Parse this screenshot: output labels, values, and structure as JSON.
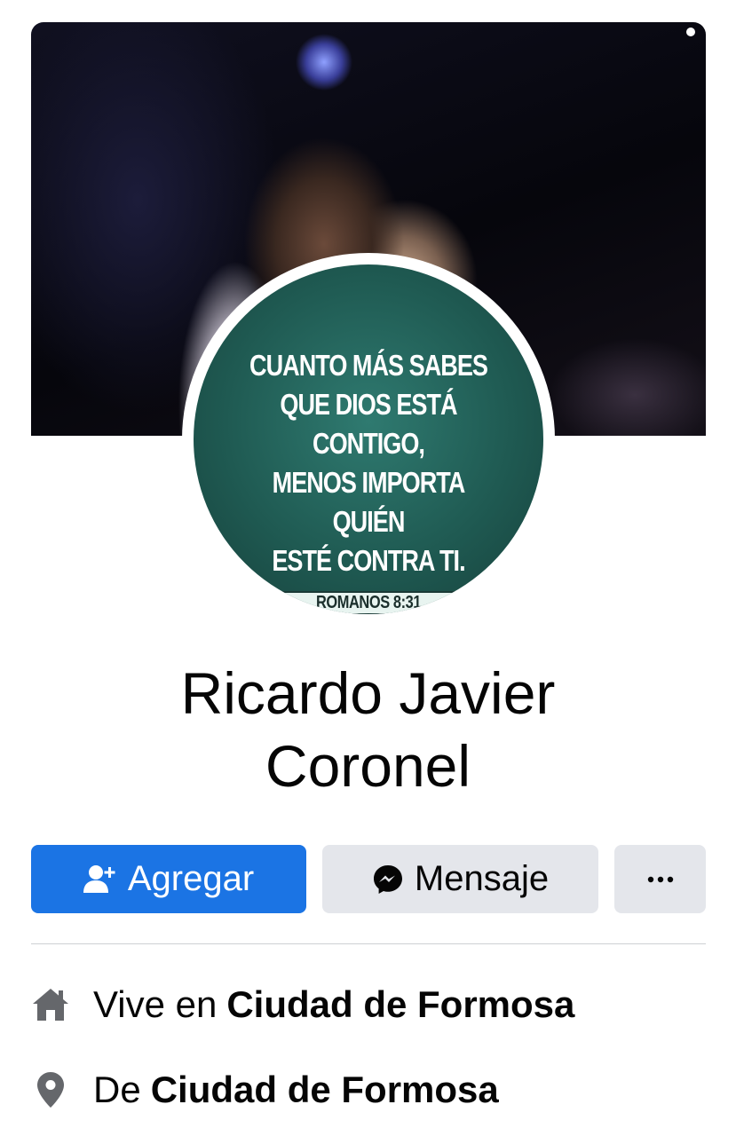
{
  "cover": {
    "alt": "Cover photo"
  },
  "profile_picture": {
    "quote_lines": [
      "CUANTO MÁS SABES",
      "QUE DIOS ESTÁ CONTIGO,",
      "MENOS IMPORTA QUIÉN",
      "ESTÉ CONTRA TI."
    ],
    "reference": "ROMANOS 8:31"
  },
  "profile": {
    "name_line_1": "Ricardo Javier",
    "name_line_2": "Coronel"
  },
  "actions": {
    "add_label": "Agregar",
    "add_icon": "add-friend-icon",
    "message_label": "Mensaje",
    "message_icon": "messenger-icon",
    "more_icon": "more-icon"
  },
  "info": {
    "lives_in_prefix": "Vive en",
    "lives_in_value": "Ciudad de Formosa",
    "lives_in_icon": "home-icon",
    "from_prefix": "De",
    "from_value": "Ciudad de Formosa",
    "from_icon": "location-pin-icon"
  },
  "colors": {
    "primary": "#1b74e4",
    "secondary_button": "#e4e6eb",
    "icon_gray": "#65676b",
    "text": "#050505"
  }
}
